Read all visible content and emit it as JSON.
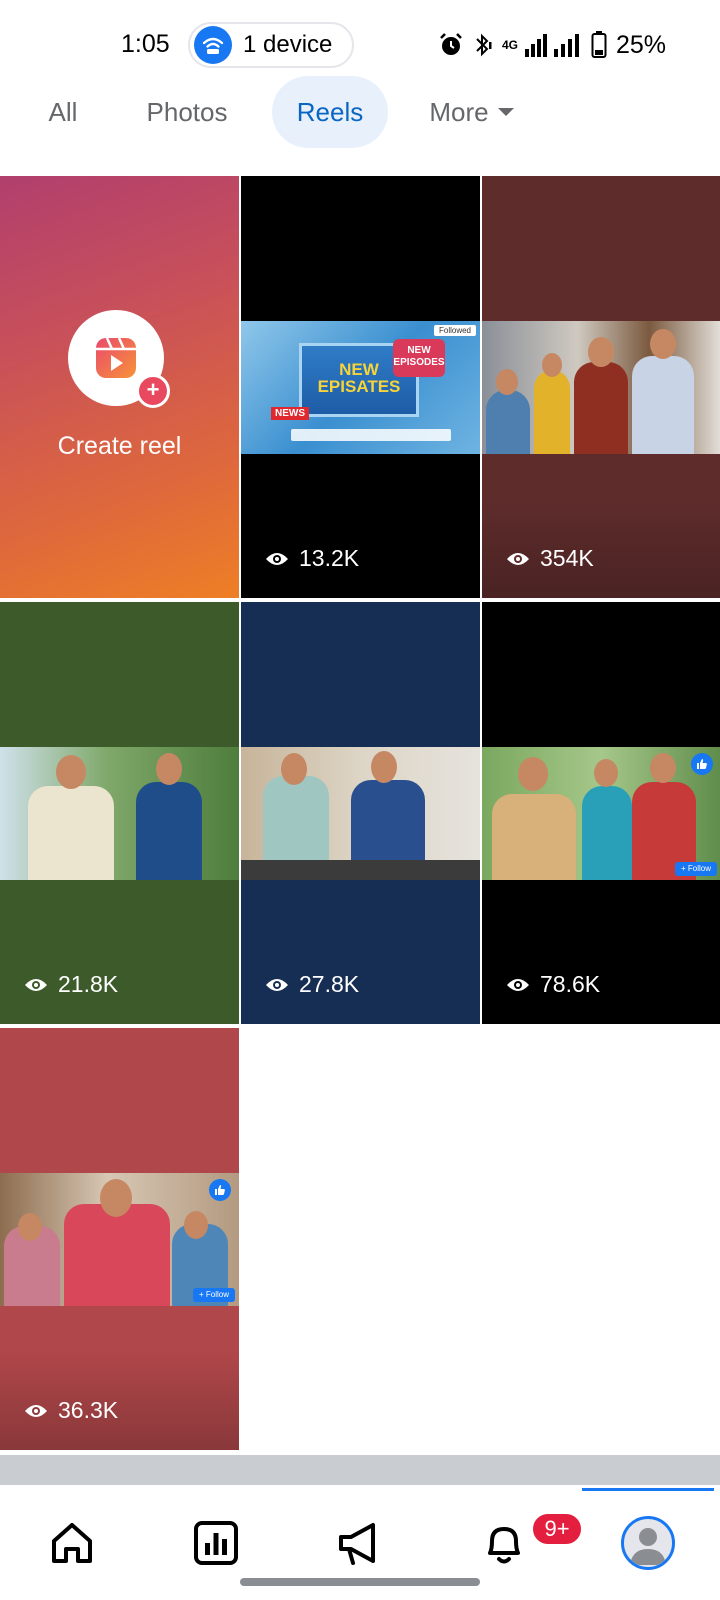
{
  "status_bar": {
    "time": "1:05",
    "device_pill": "1 device",
    "network_tag": "4G",
    "battery": "25%"
  },
  "tabs": [
    {
      "label": "All",
      "active": false
    },
    {
      "label": "Photos",
      "active": false
    },
    {
      "label": "Reels",
      "active": true
    },
    {
      "label": "More",
      "active": false
    }
  ],
  "create_reel": {
    "label": "Create reel"
  },
  "reels": [
    {
      "views": "13.2K",
      "background": "#000000",
      "thumb_title": "NEW EPISATES",
      "thumb_badge": "NEW EPISODES",
      "thumb_chip": "Followed",
      "thumb_tag": "NEWS"
    },
    {
      "views": "354K",
      "background": "#5f2c2c"
    },
    {
      "views": "21.8K",
      "background": "#3c5a2a"
    },
    {
      "views": "27.8K",
      "background": "#172e54"
    },
    {
      "views": "78.6K",
      "background": "#000000",
      "thumb_chip": "+ Follow"
    },
    {
      "views": "36.3K",
      "background": "#b0474a",
      "thumb_chip": "+ Follow"
    }
  ],
  "bottom_nav": {
    "items": [
      "home-icon",
      "insights-icon",
      "megaphone-icon",
      "bell-icon",
      "profile-avatar"
    ],
    "notification_badge": "9+"
  },
  "colors": {
    "accent": "#1877f2",
    "tab_active_bg": "#e7f0fb",
    "badge_red": "#e41e3f"
  }
}
